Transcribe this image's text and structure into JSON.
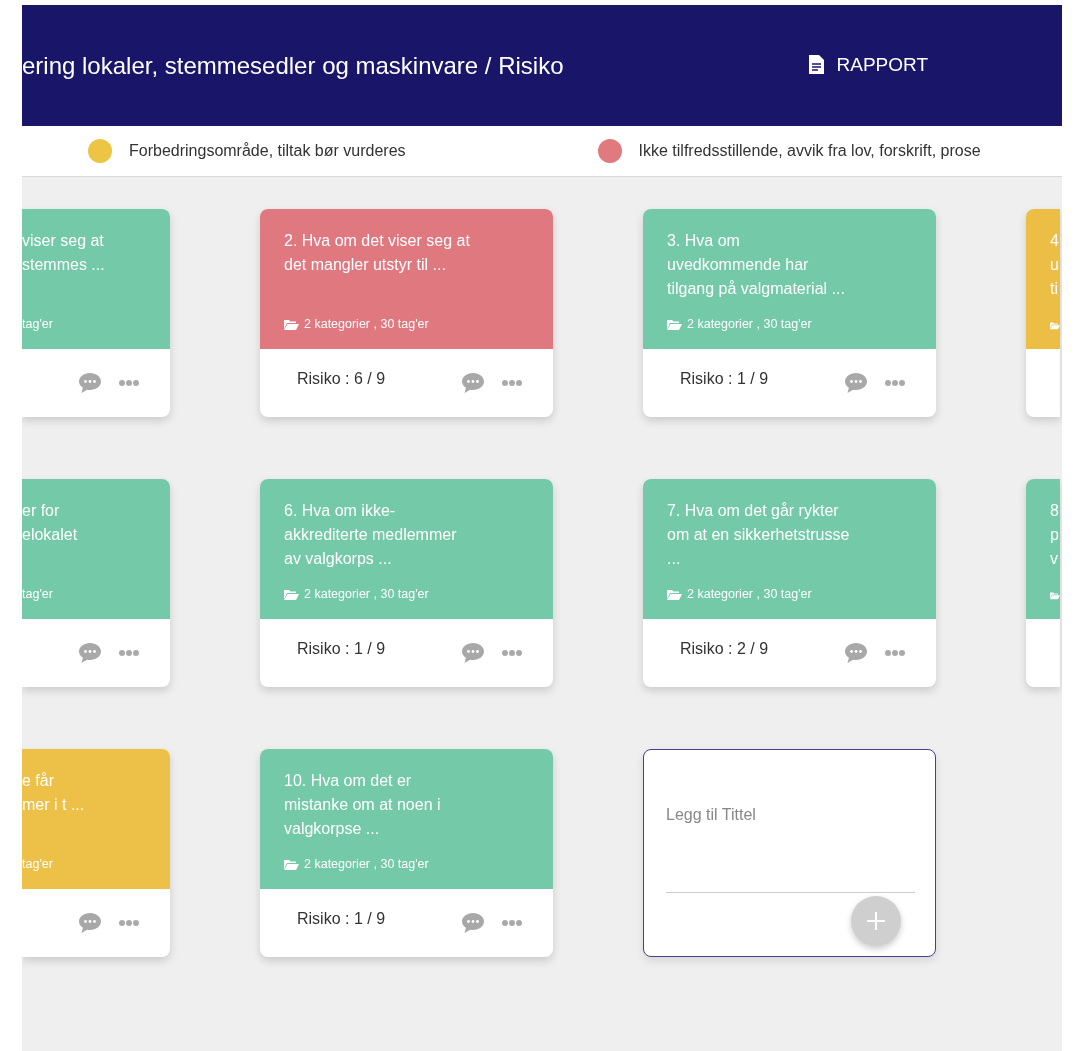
{
  "header": {
    "title": "ering lokaler, stemmesedler og maskinvare / Risiko",
    "report_button": "RAPPORT"
  },
  "legend": [
    {
      "label": "Forbedringsområde, tiltak bør vurderes",
      "color": "#ecc544"
    },
    {
      "label": "Ikke tilfredsstillende, avvik fra lov, forskrift, prose",
      "color": "#e07a7e"
    }
  ],
  "rows": [
    {
      "cards": [
        {
          "kind": "clipped-left",
          "color": "#74c9a8",
          "title_lines": [
            "viser seg at",
            "stemmes ..."
          ],
          "tags": "tag'er"
        },
        {
          "kind": "full",
          "color": "#e07880",
          "title_lines": [
            "2. Hva om det viser seg at",
            "det mangler utstyr til ..."
          ],
          "tags": "2 kategorier , 30 tag'er",
          "risk": "Risiko : 6 / 9"
        },
        {
          "kind": "full",
          "color": "#74c9a8",
          "title_lines": [
            "3. Hva om",
            "uvedkommende har",
            "tilgang på valgmaterial ..."
          ],
          "tags": "2 kategorier , 30 tag'er",
          "risk": "Risiko : 1 / 9"
        },
        {
          "kind": "clipped-right",
          "color": "#edbe45",
          "title_lines": [
            "4",
            "u",
            "ti"
          ]
        }
      ]
    },
    {
      "cards": [
        {
          "kind": "clipped-left",
          "color": "#74c9a8",
          "title_lines": [
            "er for",
            "elokalet"
          ],
          "tags": "tag'er"
        },
        {
          "kind": "full",
          "color": "#74c9a8",
          "title_lines": [
            "6. Hva om ikke-",
            "akkrediterte medlemmer",
            "av valgkorps ..."
          ],
          "tags": "2 kategorier , 30 tag'er",
          "risk": "Risiko : 1 / 9"
        },
        {
          "kind": "full",
          "color": "#74c9a8",
          "title_lines": [
            "7. Hva om det går rykter",
            "om at en sikkerhetstrusse",
            "..."
          ],
          "tags": "2 kategorier , 30 tag'er",
          "risk": "Risiko : 2 / 9"
        },
        {
          "kind": "clipped-right",
          "color": "#74c9a8",
          "title_lines": [
            "8",
            "p",
            "v"
          ]
        }
      ]
    },
    {
      "cards": [
        {
          "kind": "clipped-left",
          "color": "#edc048",
          "title_lines": [
            "e får",
            "mer i t ..."
          ],
          "tags": "tag'er"
        },
        {
          "kind": "full",
          "color": "#74c9a8",
          "title_lines": [
            "10. Hva om det er",
            "mistanke om at noen i",
            "valgkorpse ..."
          ],
          "tags": "2 kategorier , 30 tag'er",
          "risk": "Risiko : 1 / 9"
        },
        {
          "kind": "add",
          "placeholder": "Legg til Tittel"
        }
      ]
    }
  ]
}
